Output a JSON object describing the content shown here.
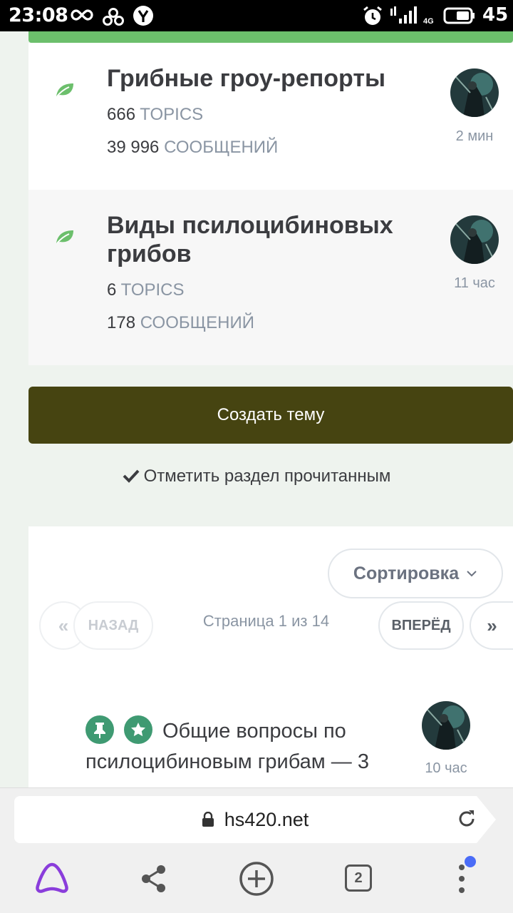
{
  "status_bar": {
    "time": "23:08",
    "network": "4G",
    "battery": "45"
  },
  "forums": [
    {
      "title": "Грибные гроу-репорты",
      "topics_count": "666",
      "topics_unit": "TOPICS",
      "posts_count": "39 996",
      "posts_unit": "СООБЩЕНИЙ",
      "last_post_ago": "2 мин"
    },
    {
      "title": "Виды псилоцибиновых грибов",
      "topics_count": "6",
      "topics_unit": "TOPICS",
      "posts_count": "178",
      "posts_unit": "СООБЩЕНИЙ",
      "last_post_ago": "11 час"
    }
  ],
  "actions": {
    "create_topic": "Создать тему",
    "mark_read": "Отметить раздел прочитанным"
  },
  "pagination": {
    "sort_label": "Сортировка",
    "prev_label": "НАЗАД",
    "next_label": "ВПЕРЁД",
    "page_info": "Страница 1 из 14"
  },
  "topics": [
    {
      "title": "Общие вопросы по псилоцибиновым грибам — 3",
      "last_post_ago": "10 час",
      "pinned": true,
      "featured": true
    }
  ],
  "browser": {
    "url": "hs420.net",
    "tabs_count": "2"
  },
  "colors": {
    "accent_green": "#6cbf6c",
    "create_button": "#464411",
    "badge_green": "#3f9a72",
    "notification_dot": "#4a6cf7",
    "alice_purple": "#8a3ddb"
  }
}
